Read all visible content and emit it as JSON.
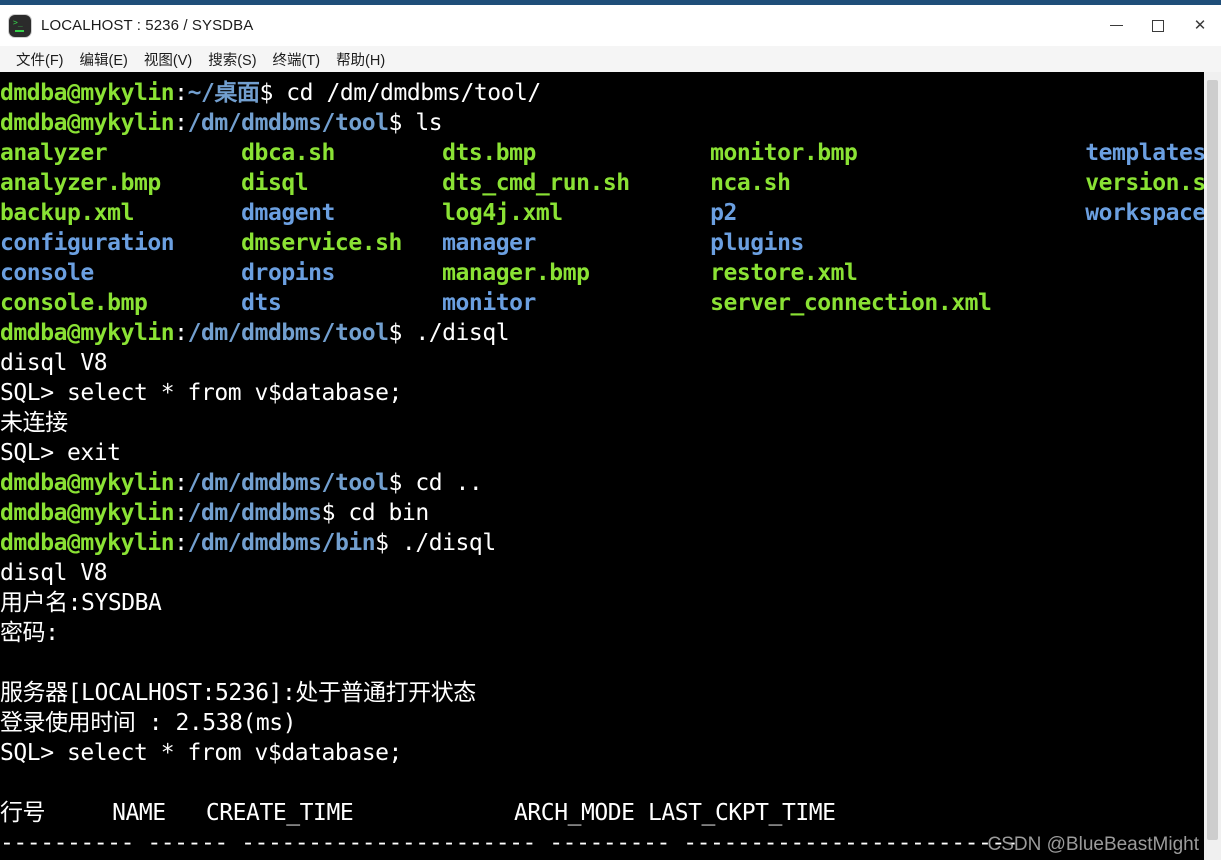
{
  "window": {
    "title": "LOCALHOST : 5236 / SYSDBA",
    "icon": "terminal-icon",
    "accent_color": "#1f4e79",
    "controls": {
      "minimize": "—",
      "maximize": "□",
      "close": "✕"
    }
  },
  "menubar": {
    "items": [
      {
        "label": "文件(F)"
      },
      {
        "label": "编辑(E)"
      },
      {
        "label": "视图(V)"
      },
      {
        "label": "搜索(S)"
      },
      {
        "label": "终端(T)"
      },
      {
        "label": "帮助(H)"
      }
    ]
  },
  "terminal": {
    "colors": {
      "background": "#000000",
      "foreground": "#ffffff",
      "prompt_user": "#8ae234",
      "prompt_path": "#729fcf",
      "directory": "#6b9fe0",
      "file": "#8ae234"
    },
    "prompt_user_host": "dmdba@mykylin",
    "lines": [
      {
        "type": "prompt",
        "user": "dmdba@mykylin",
        "sep": ":",
        "path": "~/桌面",
        "dollar": "$ ",
        "command": "cd /dm/dmdbms/tool/"
      },
      {
        "type": "prompt",
        "user": "dmdba@mykylin",
        "sep": ":",
        "path": "/dm/dmdbms/tool",
        "dollar": "$ ",
        "command": "ls"
      },
      {
        "type": "ls",
        "cells": [
          {
            "text": "analyzer",
            "kind": "file"
          },
          {
            "text": "dbca.sh",
            "kind": "file"
          },
          {
            "text": "dts.bmp",
            "kind": "file"
          },
          {
            "text": "monitor.bmp",
            "kind": "file"
          },
          {
            "text": "templates",
            "kind": "dir"
          }
        ]
      },
      {
        "type": "ls",
        "cells": [
          {
            "text": "analyzer.bmp",
            "kind": "file"
          },
          {
            "text": "disql",
            "kind": "file"
          },
          {
            "text": "dts_cmd_run.sh",
            "kind": "file"
          },
          {
            "text": "nca.sh",
            "kind": "file"
          },
          {
            "text": "version.sh",
            "kind": "file"
          }
        ]
      },
      {
        "type": "ls",
        "cells": [
          {
            "text": "backup.xml",
            "kind": "file"
          },
          {
            "text": "dmagent",
            "kind": "dir"
          },
          {
            "text": "log4j.xml",
            "kind": "file"
          },
          {
            "text": "p2",
            "kind": "dir"
          },
          {
            "text": "workspace",
            "kind": "dir"
          }
        ]
      },
      {
        "type": "ls",
        "cells": [
          {
            "text": "configuration",
            "kind": "dir"
          },
          {
            "text": "dmservice.sh",
            "kind": "file"
          },
          {
            "text": "manager",
            "kind": "dir"
          },
          {
            "text": "plugins",
            "kind": "dir"
          },
          {
            "text": "",
            "kind": "file"
          }
        ]
      },
      {
        "type": "ls",
        "cells": [
          {
            "text": "console",
            "kind": "dir"
          },
          {
            "text": "dropins",
            "kind": "dir"
          },
          {
            "text": "manager.bmp",
            "kind": "file"
          },
          {
            "text": "restore.xml",
            "kind": "file"
          },
          {
            "text": "",
            "kind": "file"
          }
        ]
      },
      {
        "type": "ls",
        "cells": [
          {
            "text": "console.bmp",
            "kind": "file"
          },
          {
            "text": "dts",
            "kind": "dir"
          },
          {
            "text": "monitor",
            "kind": "dir"
          },
          {
            "text": "server_connection.xml",
            "kind": "file"
          },
          {
            "text": "",
            "kind": "file"
          }
        ]
      },
      {
        "type": "prompt",
        "user": "dmdba@mykylin",
        "sep": ":",
        "path": "/dm/dmdbms/tool",
        "dollar": "$ ",
        "command": "./disql"
      },
      {
        "type": "plain",
        "text": "disql V8"
      },
      {
        "type": "plain",
        "text": "SQL> select * from v$database;"
      },
      {
        "type": "plain",
        "text": "未连接"
      },
      {
        "type": "plain",
        "text": "SQL> exit"
      },
      {
        "type": "prompt",
        "user": "dmdba@mykylin",
        "sep": ":",
        "path": "/dm/dmdbms/tool",
        "dollar": "$ ",
        "command": "cd .."
      },
      {
        "type": "prompt",
        "user": "dmdba@mykylin",
        "sep": ":",
        "path": "/dm/dmdbms",
        "dollar": "$ ",
        "command": "cd bin"
      },
      {
        "type": "prompt",
        "user": "dmdba@mykylin",
        "sep": ":",
        "path": "/dm/dmdbms/bin",
        "dollar": "$ ",
        "command": "./disql"
      },
      {
        "type": "plain",
        "text": "disql V8"
      },
      {
        "type": "plain",
        "text": "用户名:SYSDBA"
      },
      {
        "type": "plain",
        "text": "密码:"
      },
      {
        "type": "plain",
        "text": ""
      },
      {
        "type": "plain",
        "text": "服务器[LOCALHOST:5236]:处于普通打开状态"
      },
      {
        "type": "plain",
        "text": "登录使用时间 : 2.538(ms)"
      },
      {
        "type": "plain",
        "text": "SQL> select * from v$database;"
      },
      {
        "type": "plain",
        "text": ""
      },
      {
        "type": "plain",
        "text": "行号     NAME   CREATE_TIME            ARCH_MODE LAST_CKPT_TIME"
      },
      {
        "type": "plain",
        "text": "---------- ------ ---------------------- --------- -------------------------"
      }
    ]
  },
  "scrollbar": {
    "orientation": "vertical",
    "thumb_label": "scroll-thumb"
  },
  "watermark": {
    "text": "CSDN @BlueBeastMight",
    "color": "#9b9b9b"
  }
}
